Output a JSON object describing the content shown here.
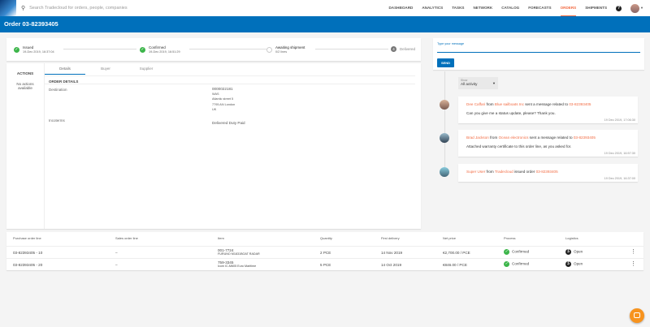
{
  "header": {
    "search_placeholder": "Search Tradecloud for orders, people, companies",
    "nav": [
      "DASHBOARD",
      "ANALYTICS",
      "TASKS",
      "NETWORK",
      "CATALOG",
      "FORECASTS",
      "ORDERS",
      "SHIPMENTS"
    ],
    "active": "ORDERS",
    "help": "?"
  },
  "title": "Order 03-82393405",
  "steps": [
    {
      "label": "Issued",
      "sub": "19-Dec 2019, 16:37:04"
    },
    {
      "label": "Confirmed",
      "sub": "19-Dec 2019, 16:51:29"
    },
    {
      "label": "Awaiting shipment",
      "sub": "0/2 lines"
    },
    {
      "num": "4",
      "label": "Delivered"
    }
  ],
  "actions": {
    "title": "ACTIONS",
    "empty": "No actions available"
  },
  "tabs": [
    "Details",
    "Buyer",
    "Supplier"
  ],
  "details": {
    "heading": "ORDER DETAILS",
    "destination_label": "Destination",
    "destination": [
      "0000022181",
      "WAS",
      "Atlantic street 5",
      "7795 AN London",
      "UK"
    ],
    "incoterms_label": "Incoterms",
    "incoterms": "Delivered Duty Paid"
  },
  "message": {
    "placeholder": "Type your message",
    "send": "SEND"
  },
  "filter": {
    "label": "Show",
    "value": "All activity"
  },
  "activity": [
    {
      "user": "Dee Caffari",
      "from": "from",
      "company": "Blue sailboats Inc",
      "action": "sent a message related to",
      "order": "03-82393405",
      "text": "Can you give me a status update, please? Thank you.",
      "time": "19 Dec 2019, 17:06:30"
    },
    {
      "user": "Brad Jackson",
      "from": "from",
      "company": "Ocean electronics",
      "action": "sent a message related to",
      "order": "03-82393405",
      "text": "Attached warranty certificate to this order line, as you asked for.",
      "time": "19 Dec 2019, 16:57:30"
    },
    {
      "user": "Super User",
      "from": "from",
      "company": "Tradecloud",
      "action": "issued order",
      "order": "03-82393405",
      "time": "19 Dec 2019, 16:37:00"
    }
  ],
  "table": {
    "headers": [
      "Purchase order line",
      "Sales order line",
      "Item",
      "Quantity",
      "First delivery",
      "Net price",
      "Process",
      "Logistics"
    ],
    "rows": [
      {
        "po": "03-82393405 - 10",
        "so": "–",
        "item": "001-7724",
        "desc": "FURUNO M1831BOAT RADAR",
        "qty": "2 PCE",
        "delivery": "14 Nov 2019",
        "price": "€2,700.00 / PCE",
        "process": "Confirmed",
        "logistics": "Open"
      },
      {
        "po": "03-82393405 - 20",
        "so": "–",
        "item": "759-3345",
        "desc": "Icom IC-M605 Euro Maritime",
        "qty": "5 PCE",
        "delivery": "14 Oct 2019",
        "price": "€846.00 / PCE",
        "process": "Confirmed",
        "logistics": "Open"
      }
    ]
  },
  "colors": {
    "brand": "#0070bb",
    "accent": "#f26b43",
    "success": "#3cb54a"
  }
}
